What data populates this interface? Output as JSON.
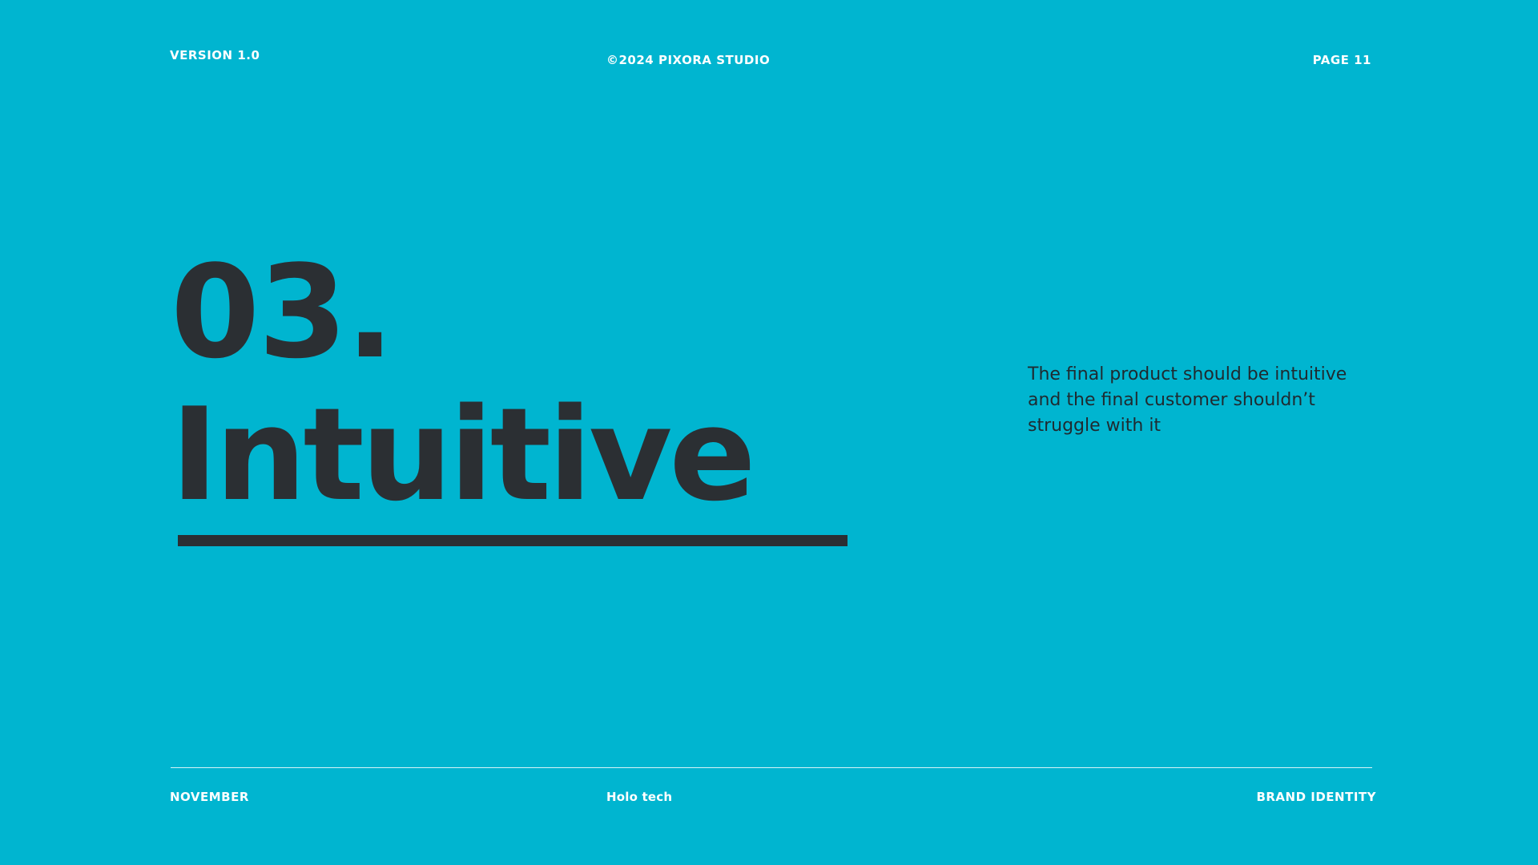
{
  "header": {
    "version": "VERSION 1.0",
    "copyright": "©2024 PIXORA STUDIO",
    "page": "PAGE 11"
  },
  "main": {
    "section_number": "03.",
    "section_title": "Intuitive",
    "description": "The final product should be intuitive and the final customer shouldn’t struggle with it"
  },
  "footer": {
    "month": "NOVEMBER",
    "client": "Holo tech",
    "section": "BRAND IDENTITY"
  },
  "colors": {
    "background": "#00B5D0",
    "headline": "#2B2F33",
    "header_text": "#FFFFFF",
    "body_text": "#1F2A30"
  }
}
